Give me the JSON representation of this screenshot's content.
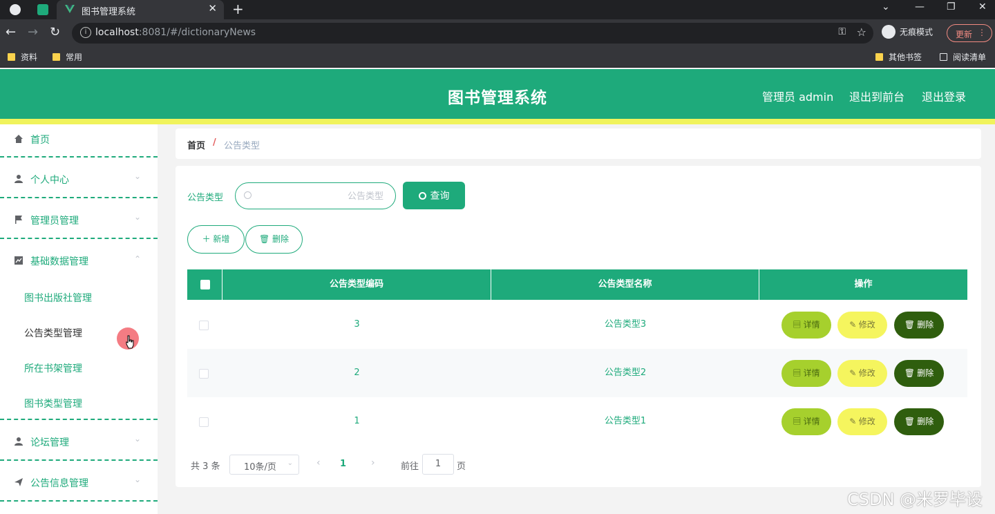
{
  "browser": {
    "tab_title": "图书管理系统",
    "url_host": "localhost",
    "url_rest": ":8081/#/dictionaryNews",
    "incognito_label": "无痕模式",
    "update_label": "更新",
    "bookmarks": [
      "资料",
      "常用"
    ],
    "bookmarks_right": [
      "其他书签",
      "阅读清单"
    ]
  },
  "header": {
    "title": "图书管理系统",
    "admin_label": "管理员 admin",
    "to_front": "退出到前台",
    "logout": "退出登录"
  },
  "sidebar": {
    "items": [
      {
        "label": "首页",
        "icon": "home-icon"
      },
      {
        "label": "个人中心",
        "icon": "user-icon"
      },
      {
        "label": "管理员管理",
        "icon": "flag-icon"
      },
      {
        "label": "基础数据管理",
        "icon": "chart-icon"
      },
      {
        "label": "论坛管理",
        "icon": "user-icon"
      },
      {
        "label": "公告信息管理",
        "icon": "send-icon"
      }
    ],
    "sub_items": [
      "图书出版社管理",
      "公告类型管理",
      "所在书架管理",
      "图书类型管理"
    ]
  },
  "breadcrumb": {
    "home": "首页",
    "sep": "/",
    "current": "公告类型"
  },
  "search": {
    "label": "公告类型",
    "placeholder": "公告类型",
    "button": "查询"
  },
  "actions": {
    "add": "新增",
    "delete": "删除"
  },
  "table": {
    "headers": [
      "公告类型编码",
      "公告类型名称",
      "操作"
    ],
    "rows": [
      {
        "code": "3",
        "name": "公告类型3"
      },
      {
        "code": "2",
        "name": "公告类型2"
      },
      {
        "code": "1",
        "name": "公告类型1"
      }
    ],
    "row_actions": {
      "detail": "详情",
      "edit": "修改",
      "delete": "删除"
    }
  },
  "pagination": {
    "total": "共 3 条",
    "page_size": "10条/页",
    "current_page": "1",
    "jump_prefix": "前往",
    "jump_value": "1",
    "jump_suffix": "页"
  },
  "watermark": "CSDN @米罗毕设",
  "colors": {
    "primary": "#1eaa7b",
    "accent_yellow": "#f0f35c",
    "detail": "#a6d02d",
    "edit": "#f5f55e",
    "delete": "#2f5e0e"
  }
}
